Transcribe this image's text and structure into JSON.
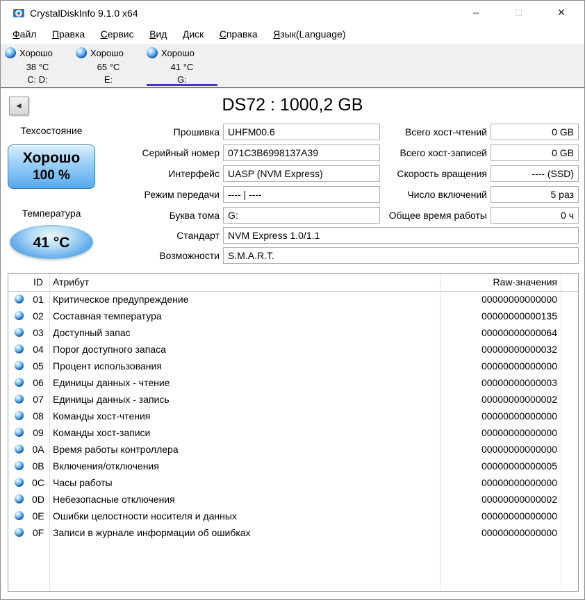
{
  "colors": {
    "status_good_blue": "#2d7fd6",
    "selected_tab_underline": "#4433cc",
    "health_gradient_top": "#dbeeff",
    "health_gradient_bottom": "#55a9ee",
    "tabstrip_background": "#f0f0f0"
  },
  "window": {
    "title": "CrystalDiskInfo 9.1.0 x64",
    "controls": {
      "minimize": "–",
      "maximize": "□",
      "close": "✕"
    }
  },
  "menu": {
    "items": [
      "Файл",
      "Правка",
      "Сервис",
      "Вид",
      "Диск",
      "Справка",
      "Язык(Language)"
    ]
  },
  "drive_tabs": [
    {
      "status": "Хорошо",
      "temperature": "38 °C",
      "letters": "C: D:"
    },
    {
      "status": "Хорошо",
      "temperature": "65 °C",
      "letters": "E:"
    },
    {
      "status": "Хорошо",
      "temperature": "41 °C",
      "letters": "G:"
    }
  ],
  "toolbar": {
    "back_icon": "◄"
  },
  "drive": {
    "title": "DS72 : 1000,2 GB",
    "health": {
      "label": "Техсостояние",
      "status": "Хорошо",
      "percent": "100 %"
    },
    "temperature": {
      "label": "Температура",
      "value": "41 °C"
    }
  },
  "fields_left": [
    {
      "label": "Прошивка",
      "value": "UHFM00.6"
    },
    {
      "label": "Серийный номер",
      "value": "071C3B6998137A39"
    },
    {
      "label": "Интерфейс",
      "value": "UASP (NVM Express)"
    },
    {
      "label": "Режим передачи",
      "value": "---- | ----"
    },
    {
      "label": "Буква тома",
      "value": "G:"
    },
    {
      "label": "Стандарт",
      "value": "NVM Express 1.0/1.1"
    },
    {
      "label": "Возможности",
      "value": "S.M.A.R.T."
    }
  ],
  "fields_right": [
    {
      "label": "Всего хост-чтений",
      "value": "0 GB"
    },
    {
      "label": "Всего хост-записей",
      "value": "0 GB"
    },
    {
      "label": "Скорость вращения",
      "value": "---- (SSD)"
    },
    {
      "label": "Число включений",
      "value": "5 раз"
    },
    {
      "label": "Общее время работы",
      "value": "0 ч"
    }
  ],
  "smart_table": {
    "headers": {
      "id": "ID",
      "attribute": "Атрибут",
      "raw": "Raw-значения"
    },
    "rows": [
      {
        "id": "01",
        "name": "Критическое предупреждение",
        "raw": "00000000000000"
      },
      {
        "id": "02",
        "name": "Составная температура",
        "raw": "00000000000135"
      },
      {
        "id": "03",
        "name": "Доступный запас",
        "raw": "00000000000064"
      },
      {
        "id": "04",
        "name": "Порог доступного запаса",
        "raw": "00000000000032"
      },
      {
        "id": "05",
        "name": "Процент использования",
        "raw": "00000000000000"
      },
      {
        "id": "06",
        "name": "Единицы данных - чтение",
        "raw": "00000000000003"
      },
      {
        "id": "07",
        "name": "Единицы данных - запись",
        "raw": "00000000000002"
      },
      {
        "id": "08",
        "name": "Команды хост-чтения",
        "raw": "00000000000000"
      },
      {
        "id": "09",
        "name": "Команды хост-записи",
        "raw": "00000000000000"
      },
      {
        "id": "0A",
        "name": "Время работы контроллера",
        "raw": "00000000000000"
      },
      {
        "id": "0B",
        "name": "Включения/отключения",
        "raw": "00000000000005"
      },
      {
        "id": "0C",
        "name": "Часы работы",
        "raw": "00000000000000"
      },
      {
        "id": "0D",
        "name": "Небезопасные отключения",
        "raw": "00000000000002"
      },
      {
        "id": "0E",
        "name": "Ошибки целостности носителя и данных",
        "raw": "00000000000000"
      },
      {
        "id": "0F",
        "name": "Записи в журнале информации об ошибках",
        "raw": "00000000000000"
      }
    ]
  }
}
